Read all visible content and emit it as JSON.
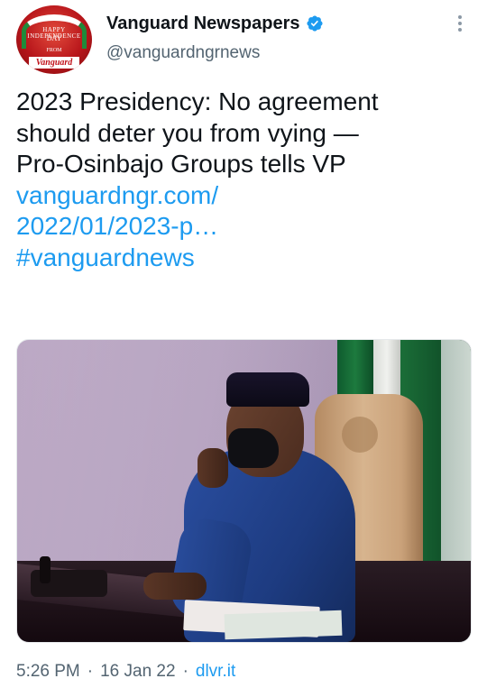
{
  "account": {
    "display_name": "Vanguard Newspapers",
    "handle": "@vanguardngrnews",
    "verified": true,
    "avatar": {
      "line1": "HAPPY INDEPENDENCE",
      "line2": "DAY",
      "line3": "FROM",
      "logo": "Vanguard"
    }
  },
  "tweet": {
    "text_lines": [
      "2023 Presidency: No agreement",
      "should deter you from vying —",
      "Pro-Osinbajo Groups tells VP"
    ],
    "link_lines": [
      "vanguardngr.com/",
      "2022/01/2023-p…"
    ],
    "hashtag": "#vanguardnews"
  },
  "meta": {
    "time": "5:26 PM",
    "date": "16 Jan 22",
    "source": "dlvr.it",
    "separator": "·"
  },
  "colors": {
    "link": "#1d9bf0",
    "secondary_text": "#536471",
    "primary_text": "#0f1419",
    "verified_badge": "#1d9bf0"
  },
  "icons": {
    "verified": "verified-badge-icon",
    "more": "more-vertical-icon"
  }
}
